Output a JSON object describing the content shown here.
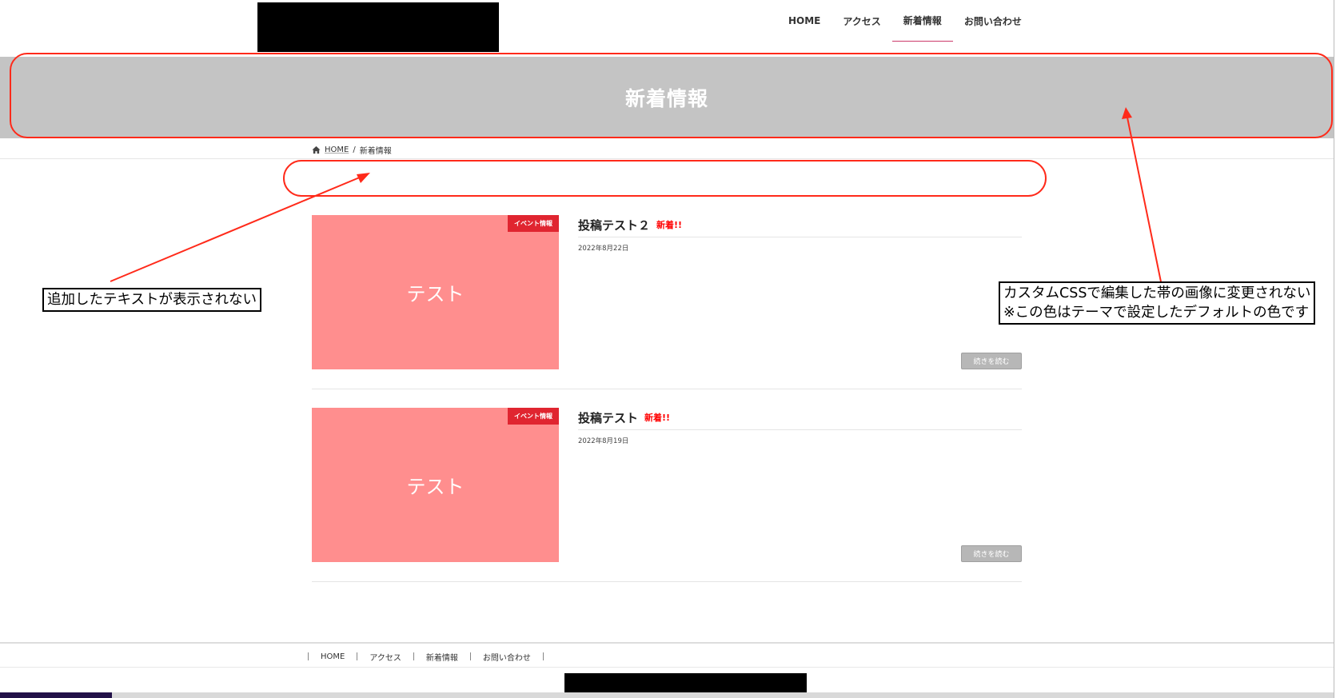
{
  "header": {
    "nav": [
      "HOME",
      "アクセス",
      "新着情報",
      "お問い合わせ"
    ],
    "active_nav": "新着情報"
  },
  "page_header": {
    "title": "新着情報"
  },
  "breadcrumb": {
    "home": "HOME",
    "separator": "/",
    "current": "新着情報"
  },
  "posts": [
    {
      "title": "投稿テスト２",
      "new_tag": "新着!!",
      "date": "2022年8月22日",
      "category": "イベント情報",
      "thumb_text": "テスト",
      "read_more": "続きを読む"
    },
    {
      "title": "投稿テスト",
      "new_tag": "新着!!",
      "date": "2022年8月19日",
      "category": "イベント情報",
      "thumb_text": "テスト",
      "read_more": "続きを読む"
    }
  ],
  "footer": {
    "nav": [
      "HOME",
      "アクセス",
      "新着情報",
      "お問い合わせ"
    ]
  },
  "annotations": {
    "left_note": "追加したテキストが表示されない",
    "right_note_line1": "カスタムCSSで編集した帯の画像に変更されない",
    "right_note_line2": "※この色はテーマで設定したデフォルトの色です"
  },
  "colors": {
    "band_gray": "#c4c4c4",
    "thumb_pink": "#ff8e8e",
    "badge_red": "#e02530",
    "new_red": "#ff0000",
    "annotation_red": "#ff2a1a",
    "nav_active_underline": "#cc3b6b"
  }
}
